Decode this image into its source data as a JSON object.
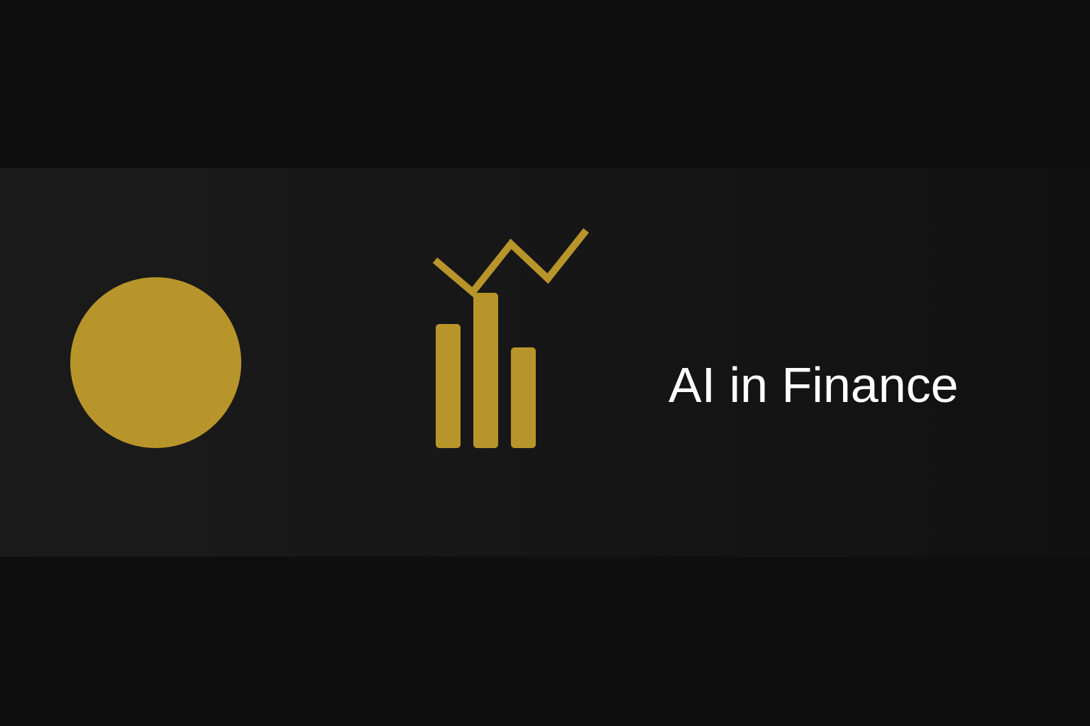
{
  "colors": {
    "background": "#0f0f0f",
    "accent": "#b8952a",
    "text": "#ffffff"
  },
  "hero": {
    "title": "AI in Finance",
    "coin_icon": "gold-coin-icon",
    "chart_icon": "bar-chart-trend-icon"
  }
}
